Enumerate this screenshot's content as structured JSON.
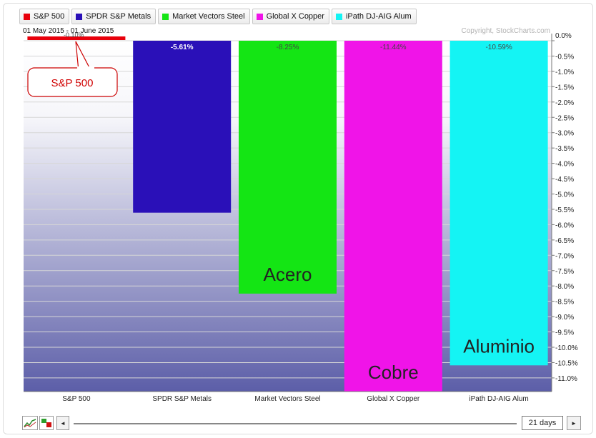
{
  "legend": [
    {
      "label": "S&P 500",
      "color": "#e8000b"
    },
    {
      "label": "SPDR S&P Metals",
      "color": "#2a10b8"
    },
    {
      "label": "Market Vectors Steel",
      "color": "#14e514"
    },
    {
      "label": "Global X Copper",
      "color": "#f014e8"
    },
    {
      "label": "iPath DJ-AIG Alum",
      "color": "#14f4f4"
    }
  ],
  "date_range": "01 May 2015 - 01 June 2015",
  "copyright": "Copyright, StockCharts.com",
  "callout_label": "S&P 500",
  "controls": {
    "period_label": "21 days",
    "left_arrow": "◄",
    "right_arrow": "►"
  },
  "chart_data": {
    "type": "bar",
    "categories": [
      "S&P 500",
      "SPDR S&P Metals",
      "Market Vectors Steel",
      "Global X Copper",
      "iPath DJ-AIG Alum"
    ],
    "values": [
      -0.1,
      -5.61,
      -8.25,
      -11.44,
      -10.59
    ],
    "data_labels": [
      "",
      "-5.61%",
      "-8.25%",
      "-11.44%",
      "-10.59%"
    ],
    "overlapping_label": "-0.10%",
    "colors": [
      "#e8000b",
      "#2a10b8",
      "#14e514",
      "#f014e8",
      "#14f4f4"
    ],
    "ylim": [
      -11.5,
      0
    ],
    "yticks": [
      "0.0%",
      "-0.5%",
      "-1.0%",
      "-1.5%",
      "-2.0%",
      "-2.5%",
      "-3.0%",
      "-3.5%",
      "-4.0%",
      "-4.5%",
      "-5.0%",
      "-5.5%",
      "-6.0%",
      "-6.5%",
      "-7.0%",
      "-7.5%",
      "-8.0%",
      "-8.5%",
      "-9.0%",
      "-9.5%",
      "-10.0%",
      "-10.5%",
      "-11.0%"
    ],
    "ytick_values": [
      0,
      -0.5,
      -1,
      -1.5,
      -2,
      -2.5,
      -3,
      -3.5,
      -4,
      -4.5,
      -5,
      -5.5,
      -6,
      -6.5,
      -7,
      -7.5,
      -8,
      -8.5,
      -9,
      -9.5,
      -10,
      -10.5,
      -11
    ],
    "grid": true,
    "annotations": [
      {
        "category_index": 2,
        "text": "Acero"
      },
      {
        "category_index": 3,
        "text": "Cobre"
      },
      {
        "category_index": 4,
        "text": "Aluminio"
      }
    ]
  }
}
